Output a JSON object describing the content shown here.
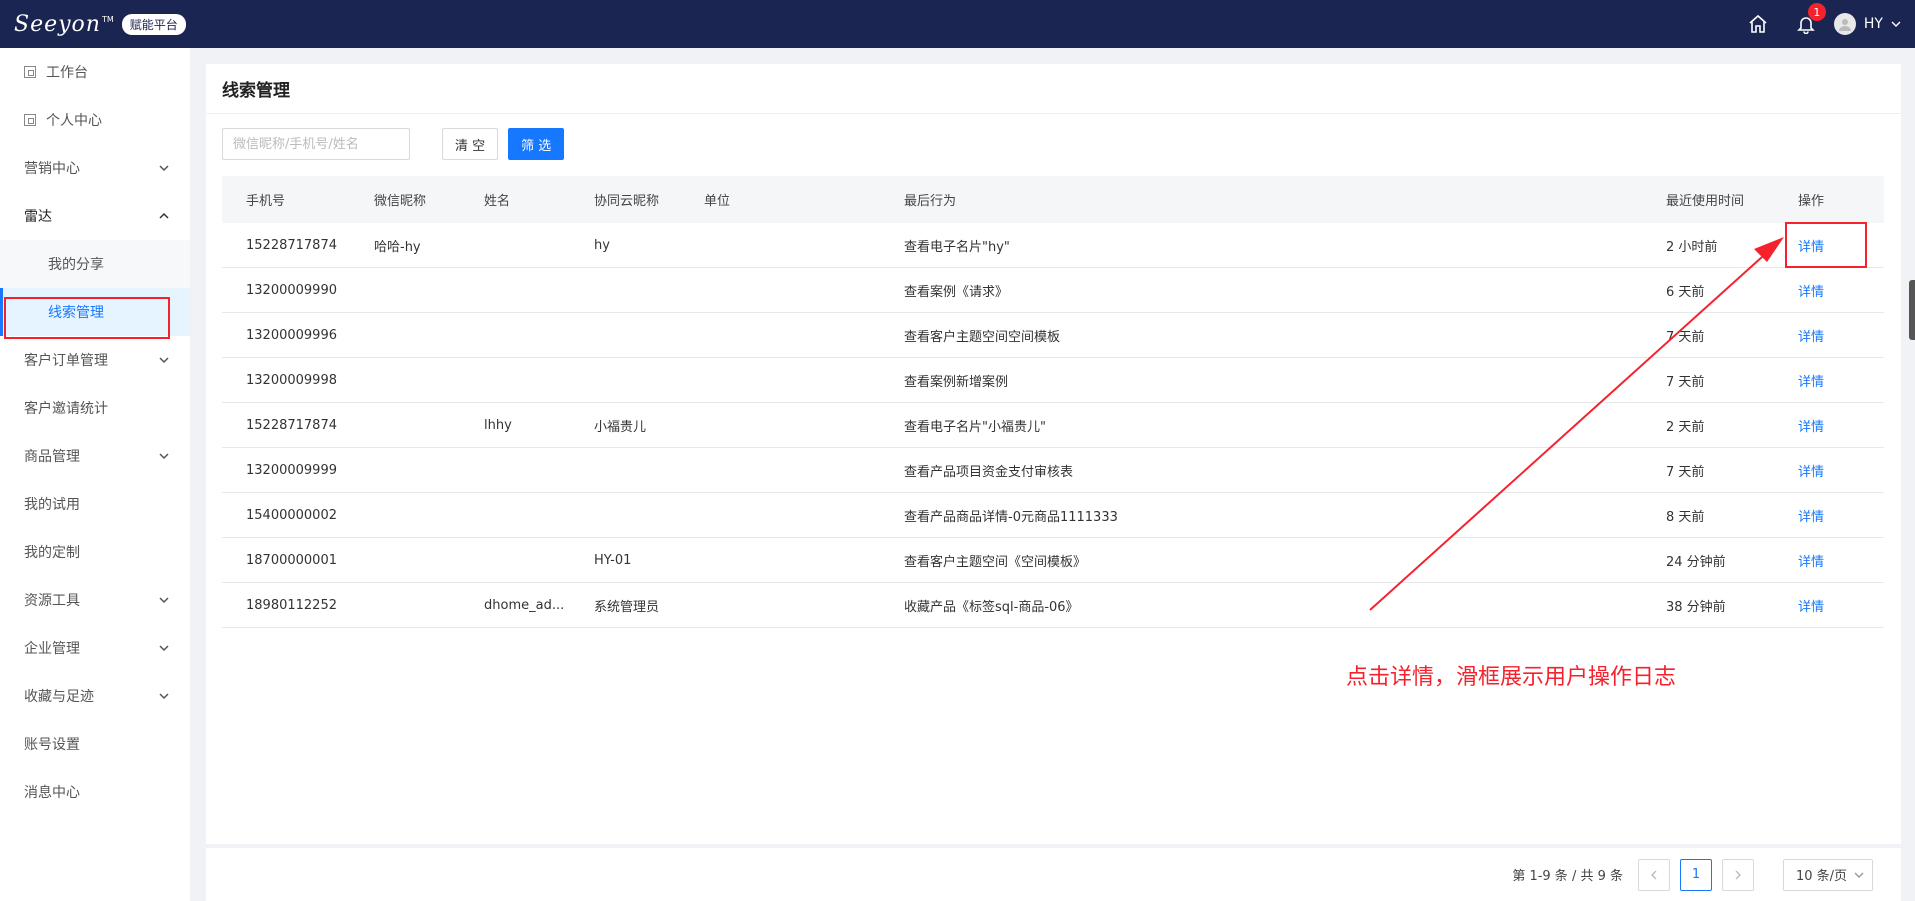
{
  "header": {
    "logo_text": "Seeyon",
    "logo_tm": "TM",
    "platform_badge": "赋能平台",
    "notification_count": "1",
    "user_name": "HY"
  },
  "sidebar": {
    "items": [
      {
        "label": "工作台"
      },
      {
        "label": "个人中心"
      },
      {
        "label": "营销中心"
      },
      {
        "label": "雷达"
      },
      {
        "label": "我的分享"
      },
      {
        "label": "线索管理"
      },
      {
        "label": "客户订单管理"
      },
      {
        "label": "客户邀请统计"
      },
      {
        "label": "商品管理"
      },
      {
        "label": "我的试用"
      },
      {
        "label": "我的定制"
      },
      {
        "label": "资源工具"
      },
      {
        "label": "企业管理"
      },
      {
        "label": "收藏与足迹"
      },
      {
        "label": "账号设置"
      },
      {
        "label": "消息中心"
      }
    ]
  },
  "main": {
    "title": "线索管理",
    "search_placeholder": "微信昵称/手机号/姓名",
    "clear_label": "清 空",
    "filter_label": "筛 选",
    "columns": [
      "手机号",
      "微信昵称",
      "姓名",
      "协同云昵称",
      "单位",
      "最后行为",
      "最近使用时间",
      "操作"
    ],
    "rows": [
      [
        "15228717874",
        "哈哈-hy",
        "",
        "hy",
        "",
        "查看电子名片\"hy\"",
        "2 小时前",
        "详情"
      ],
      [
        "13200009990",
        "",
        "",
        "",
        "",
        "查看案例《请求》",
        "6 天前",
        "详情"
      ],
      [
        "13200009996",
        "",
        "",
        "",
        "",
        "查看客户主题空间空间模板",
        "7 天前",
        "详情"
      ],
      [
        "13200009998",
        "",
        "",
        "",
        "",
        "查看案例新增案例",
        "7 天前",
        "详情"
      ],
      [
        "15228717874",
        "",
        "lhhy",
        "小福贵儿",
        "",
        "查看电子名片\"小福贵儿\"",
        "2 天前",
        "详情"
      ],
      [
        "13200009999",
        "",
        "",
        "",
        "",
        "查看产品项目资金支付审核表",
        "7 天前",
        "详情"
      ],
      [
        "15400000002",
        "",
        "",
        "",
        "",
        "查看产品商品详情-0元商品1111333",
        "8 天前",
        "详情"
      ],
      [
        "18700000001",
        "",
        "",
        "HY-01",
        "",
        "查看客户主题空间《空间模板》",
        "24 分钟前",
        "详情"
      ],
      [
        "18980112252",
        "",
        "dhome_ad...",
        "系统管理员",
        "",
        "收藏产品《标签sql-商品-06》",
        "38 分钟前",
        "详情"
      ]
    ]
  },
  "annotation": {
    "text": "点击详情，滑框展示用户操作日志",
    "color": "#f5222d"
  },
  "pagination": {
    "summary": "第 1-9 条 / 共 9 条",
    "current_page": "1",
    "page_size": "10 条/页"
  },
  "colors": {
    "header_bg": "#1b2551",
    "primary": "#1677ff",
    "highlight": "#f5222d"
  }
}
